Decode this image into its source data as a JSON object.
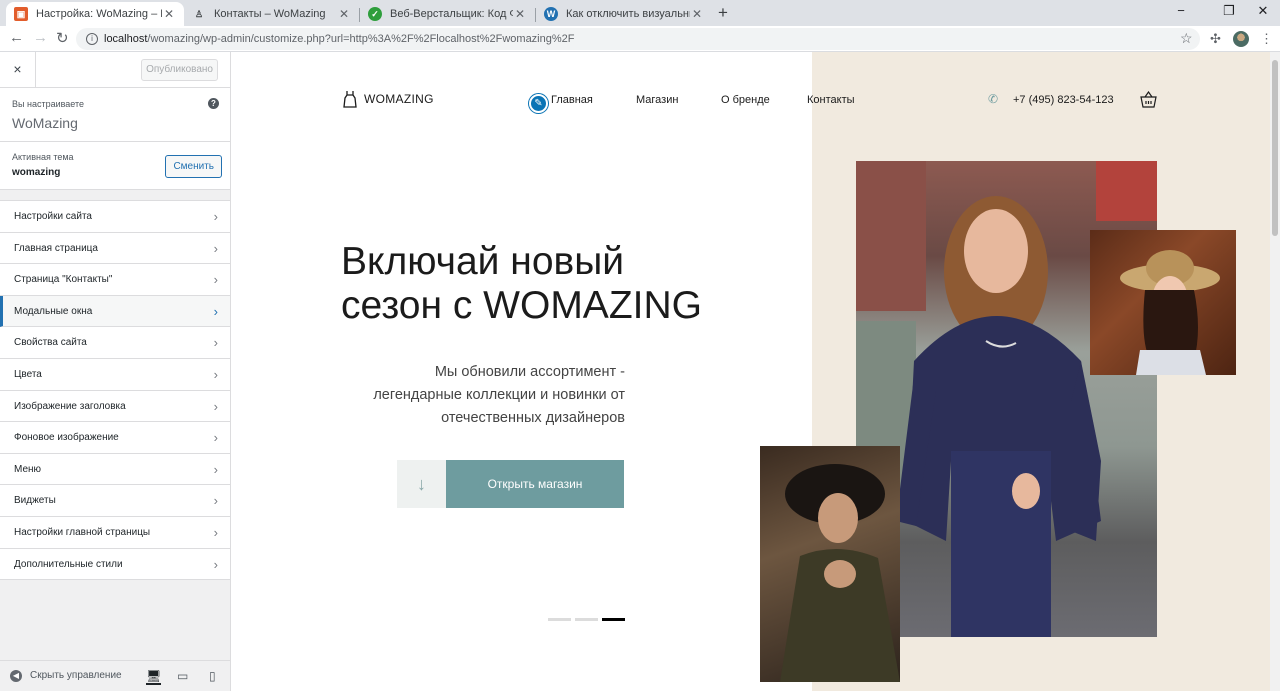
{
  "browser": {
    "tabs": [
      {
        "title": "Настройка: WoMazing – Магазин",
        "active": true,
        "favicon_color": "#e25d2c"
      },
      {
        "title": "Контакты – WoMazing",
        "active": false,
        "favicon_color": "#3c4043"
      },
      {
        "title": "Веб-Верстальщик: Код Фриланса",
        "active": false,
        "favicon_color": "#2e9e3c"
      },
      {
        "title": "Как отключить визуальный редактор",
        "active": false,
        "favicon_color": "#2271b1"
      }
    ],
    "url_host": "localhost",
    "url_path": "/womazing/wp-admin/customize.php?url=http%3A%2F%2Flocalhost%2Fwomazing%2F"
  },
  "customizer": {
    "close_icon": "×",
    "publish_label": "Опубликовано",
    "customizing_label": "Вы настраиваете",
    "site_name": "WoMazing",
    "help_icon": "?",
    "active_theme_label": "Активная тема",
    "theme_name": "womazing",
    "change_label": "Сменить",
    "sections": [
      {
        "label": "Настройки сайта"
      },
      {
        "label": "Главная страница"
      },
      {
        "label": "Страница \"Контакты\""
      },
      {
        "label": "Модальные окна",
        "active": true
      },
      {
        "label": "Свойства сайта"
      },
      {
        "label": "Цвета"
      },
      {
        "label": "Изображение заголовка"
      },
      {
        "label": "Фоновое изображение"
      },
      {
        "label": "Меню"
      },
      {
        "label": "Виджеты"
      },
      {
        "label": "Настройки главной страницы"
      },
      {
        "label": "Дополнительные стили"
      }
    ],
    "hide_controls_label": "Скрыть управление",
    "devices": [
      "desktop",
      "tablet",
      "mobile"
    ],
    "selected_device": "desktop"
  },
  "site": {
    "logo": "WOMAZING",
    "nav": [
      "Главная",
      "Магазин",
      "О бренде",
      "Контакты"
    ],
    "phone": "+7 (495) 823-54-123",
    "hero_title_line1": "Включай новый",
    "hero_title_line2": "сезон с WOMAZING",
    "hero_subtitle_line1": "Мы обновили ассортимент -",
    "hero_subtitle_line2": "легендарные коллекции и новинки от",
    "hero_subtitle_line3": "отечественных дизайнеров",
    "cta_label": "Открыть магазин",
    "slider_dots": 3,
    "active_slide": 3,
    "colors": {
      "accent": "#6e9c9f",
      "beige": "#f1eadf",
      "wp_blue": "#2271b1"
    }
  }
}
